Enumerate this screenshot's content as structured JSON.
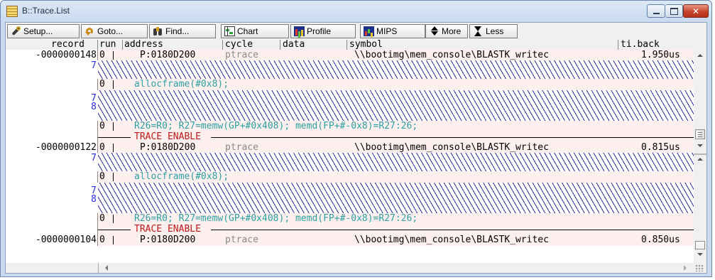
{
  "window": {
    "title": "B::Trace.List"
  },
  "toolbar": {
    "buttons": [
      {
        "label": "Setup...",
        "icon": "wrench-icon"
      },
      {
        "label": "Goto...",
        "icon": "goto-arrow-icon"
      },
      {
        "label": "Find...",
        "icon": "binoculars-icon"
      },
      {
        "label": "Chart",
        "icon": "chart-icon"
      },
      {
        "label": "Profile",
        "icon": "profile-icon"
      },
      {
        "label": "MIPS",
        "icon": "mips-icon"
      },
      {
        "label": "More",
        "icon": "updown-arrows-icon"
      },
      {
        "label": "Less",
        "icon": "hourglass-icon"
      }
    ]
  },
  "columns": {
    "record": "record",
    "run": "run",
    "address": "address",
    "cycle": "cycle",
    "data": "data",
    "symbol": "symbol",
    "tiback": "ti.back"
  },
  "blocks": [
    {
      "record": "-0000000148",
      "run": "0",
      "address": "P:0180D200",
      "cycle": "ptrace",
      "symbol": "\\\\bootimg\\mem_console\\BLASTK_writec",
      "tiback": "1.950us",
      "hatch1_num": "7",
      "hatch2_nums": [
        "7",
        "8"
      ],
      "code1_run": "0",
      "code1": "allocframe(#0x8);",
      "code2_run": "0",
      "code2": "R26=R0; R27=memw(GP+#0x408); memd(FP+#-0x8)=R27:26;",
      "trace_label": "TRACE ENABLE"
    },
    {
      "record": "-0000000122",
      "run": "0",
      "address": "P:0180D200",
      "cycle": "ptrace",
      "symbol": "\\\\bootimg\\mem_console\\BLASTK_writec",
      "tiback": "0.815us",
      "hatch1_num": "7",
      "hatch2_nums": [
        "7",
        "8"
      ],
      "code1_run": "0",
      "code1": "allocframe(#0x8);",
      "code2_run": "0",
      "code2": "R26=R0; R27=memw(GP+#0x408); memd(FP+#-0x8)=R27:26;",
      "trace_label": "TRACE ENABLE"
    }
  ],
  "last_row": {
    "record": "-0000000104",
    "run": "0",
    "address": "P:0180D200",
    "cycle": "ptrace",
    "symbol": "\\\\bootimg\\mem_console\\BLASTK_writec",
    "tiback": "0.850us"
  }
}
